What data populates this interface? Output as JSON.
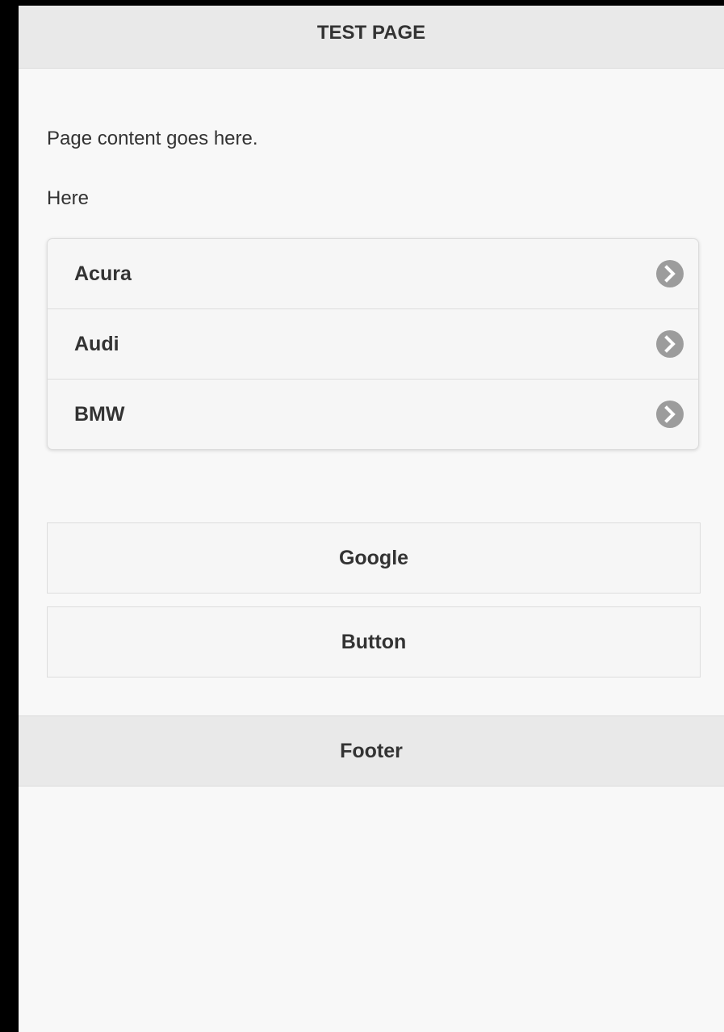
{
  "header": {
    "title": "TEST PAGE"
  },
  "content": {
    "paragraphs": [
      "Page content goes here.",
      "Here"
    ]
  },
  "listview": {
    "items": [
      {
        "label": "Acura",
        "icon": "chevron-right-circle-icon"
      },
      {
        "label": "Audi",
        "icon": "chevron-right-circle-icon"
      },
      {
        "label": "BMW",
        "icon": "chevron-right-circle-icon"
      }
    ]
  },
  "buttons": {
    "google_label": "Google",
    "button_label": "Button"
  },
  "footer": {
    "title": "Footer"
  },
  "colors": {
    "page_background": "#f8f8f8",
    "bar_background": "#e9e9e9",
    "text": "#333333",
    "icon": "#9c9c9c",
    "border": "#dddddd"
  }
}
